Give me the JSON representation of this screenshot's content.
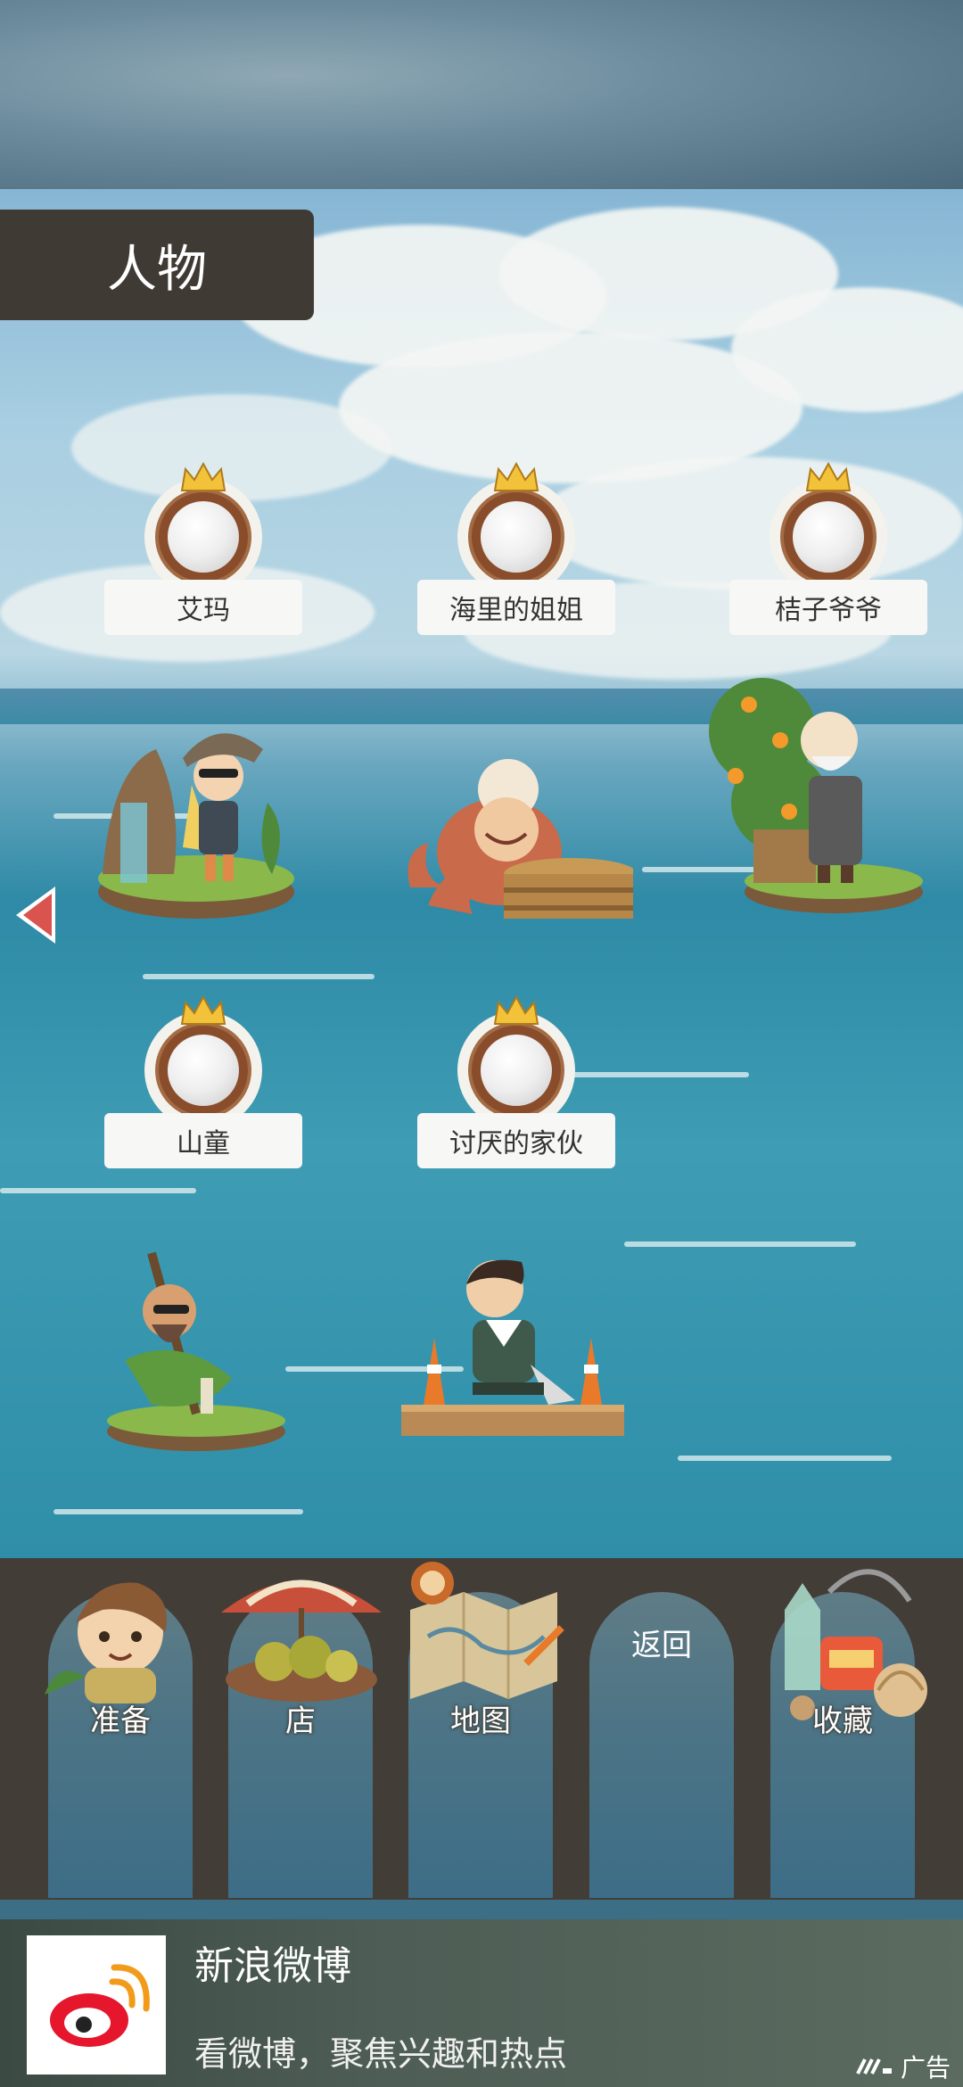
{
  "title": "人物",
  "characters": [
    {
      "name": "艾玛"
    },
    {
      "name": "海里的姐姐"
    },
    {
      "name": "桔子爷爷"
    },
    {
      "name": "山童"
    },
    {
      "name": "讨厌的家伙"
    }
  ],
  "menu": {
    "prepare": "准备",
    "shop": "店",
    "map": "地图",
    "back": "返回",
    "collection": "收藏"
  },
  "ad": {
    "title": "新浪微博",
    "description": "看微博，聚焦兴趣和热点",
    "tag": "广告"
  },
  "colors": {
    "title_bg": "#403a35",
    "menu_bg": "#433d38",
    "badge_ring": "#8a4d2c",
    "crown": "#f2c23a",
    "arrow": "#d9534f"
  }
}
